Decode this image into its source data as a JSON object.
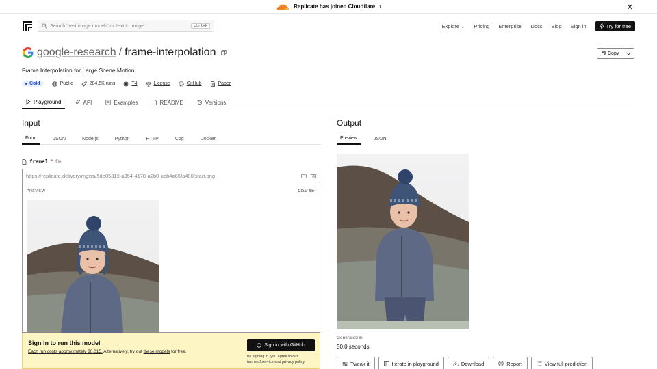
{
  "banner": {
    "text": "Replicate has joined Cloudflare",
    "chevron": "›",
    "close": "✕"
  },
  "nav": {
    "search_placeholder": "Search 'best image models' or 'text to image'",
    "search_kbd": "ctrl+k",
    "links": [
      "Explore",
      "Pricing",
      "Enterprise",
      "Docs",
      "Blog",
      "Sign in"
    ],
    "explore_chevron": "⌄",
    "cta": "Try for free"
  },
  "header": {
    "owner": "google-research",
    "separator": "/",
    "model": "frame-interpolation",
    "copy_label": "Copy",
    "description": "Frame Interpolation for Large Scene Motion",
    "meta": {
      "status": "Cold",
      "visibility": "Public",
      "runs": "284.5K runs",
      "hardware": "T4",
      "license": "License",
      "github": "GitHub",
      "paper": "Paper"
    }
  },
  "tabs": [
    "Playground",
    "API",
    "Examples",
    "README",
    "Versions"
  ],
  "input": {
    "heading": "Input",
    "subtabs": [
      "Form",
      "JSON",
      "Node.js",
      "Python",
      "HTTP",
      "Cog",
      "Docker"
    ],
    "field_name": "frame1",
    "field_required": "*",
    "field_type": "file",
    "url_placeholder": "https://replicate.delivery/mgxm/5de85319-a354-4178-a2b0-aab4a65fa480/start.png",
    "preview_label": "PREVIEW",
    "clear_label": "Clear file"
  },
  "signin": {
    "title": "Sign in to run this model",
    "cost_link": "Each run costs approximately $0.015.",
    "cost_mid": " Alternatively, try out ",
    "models_link": "these models",
    "cost_end": " for free.",
    "button": "Sign in with GitHub",
    "agree_pre": "By signing in, you agree to our",
    "terms": "terms of service",
    "and": " and ",
    "privacy": "privacy policy"
  },
  "output": {
    "heading": "Output",
    "subtabs": [
      "Preview",
      "JSON"
    ],
    "generated_label": "Generated in",
    "generated_value": "50.0 seconds",
    "actions": [
      "Tweak it",
      "Iterate in playground",
      "Download",
      "Report",
      "View full prediction"
    ]
  },
  "colors": {
    "accent_blue": "#1e4fd6",
    "cold_bg": "#e6efff",
    "signin_bg": "#fdf6c4",
    "cloudflare": "#f38020"
  }
}
